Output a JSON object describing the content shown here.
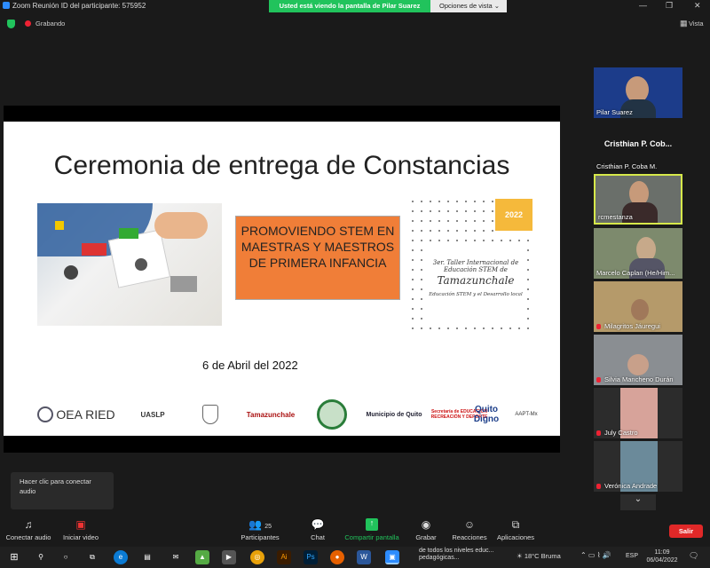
{
  "window": {
    "title": "Zoom Reunión ID del participante: 575952"
  },
  "share_banner": {
    "viewing": "Usted está viendo la pantalla de Pilar Suarez",
    "options": "Opciones de vista"
  },
  "recording": {
    "label": "Grabando"
  },
  "view_button": {
    "label": "Vista"
  },
  "slide": {
    "title": "Ceremonia de entrega de Constancias",
    "stem_box": "PROMOVIENDO STEM EN MAESTRAS Y MAESTROS DE PRIMERA INFANCIA",
    "year": "2022",
    "taller_line1": "3er. Taller Internacional de",
    "taller_line2": "Educación STEM de",
    "taller_city": "Tamazunchale",
    "taller_line3": "Educación STEM y el Desarrollo local",
    "date": "6 de Abril del 2022",
    "logos": [
      {
        "name": "oea-ried-logo",
        "text": "OEA RIED"
      },
      {
        "name": "uaslp-logo",
        "text": "UASLP"
      },
      {
        "name": "crest-logo",
        "text": ""
      },
      {
        "name": "tamazunchale-logo",
        "text": "Tamazunchale"
      },
      {
        "name": "seal-logo",
        "text": ""
      },
      {
        "name": "municipio-quito-logo",
        "text": "Municipio de Quito"
      },
      {
        "name": "secretaria-logo",
        "text": "Secretaría de EDUCACIÓN RECREACIÓN Y DEPORTE"
      },
      {
        "name": "quito-digno-logo",
        "text": "Quito Digno"
      },
      {
        "name": "aapt-logo",
        "text": "AAPT-Mx"
      }
    ]
  },
  "participants": [
    {
      "name": "Pilar Suarez",
      "muted": false,
      "kind": "video"
    },
    {
      "name": "Cristhian P. Coba M.",
      "display": "Cristhian P. Cob...",
      "muted": false,
      "kind": "name"
    },
    {
      "name": "rcmestanza",
      "muted": false,
      "kind": "video",
      "active": true
    },
    {
      "name": "Marcelo Caplan (He/Him...",
      "muted": false,
      "kind": "video"
    },
    {
      "name": "Milagritos Jáuregui",
      "muted": true,
      "kind": "video"
    },
    {
      "name": "Silvia Mancheno Durán",
      "muted": true,
      "kind": "video"
    },
    {
      "name": "July Castro",
      "muted": true,
      "kind": "video"
    },
    {
      "name": "Verónica Andrade",
      "muted": true,
      "kind": "video"
    }
  ],
  "toast": {
    "text": "Hacer clic para conectar audio"
  },
  "toolbar": {
    "audio": "Conectar audio",
    "video": "Iniciar video",
    "participants": "Participantes",
    "participants_count": "25",
    "chat": "Chat",
    "share": "Compartir pantalla",
    "record": "Grabar",
    "reactions": "Reacciones",
    "apps": "Aplicaciones",
    "leave": "Salir"
  },
  "taskbar": {
    "weather": "18°C Bruma",
    "lang": "ESP",
    "time": "11:09",
    "date": "06/04/2022",
    "chat_preview_1": "de todos los niveles educ...",
    "chat_preview_2": "pedagógicas..."
  },
  "colors": {
    "share_green": "#21c35c",
    "leave_red": "#e02828",
    "stem_orange": "#f07e38",
    "active_border": "#d6e84a"
  }
}
